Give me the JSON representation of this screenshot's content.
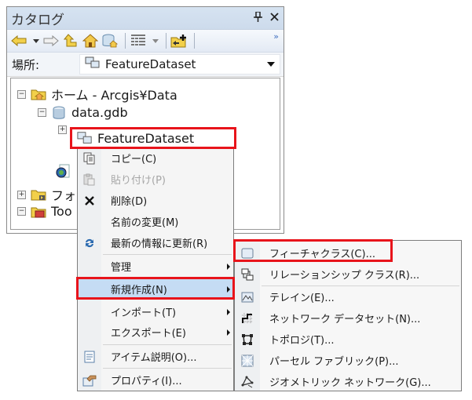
{
  "panel": {
    "title": "カタログ",
    "pin_icon": "pin-icon",
    "close_icon": "close-icon",
    "toolbar": {
      "items": [
        "back-arrow-icon",
        "back-dropdown-icon",
        "forward-arrow-icon",
        "up-one-level-icon",
        "home-icon",
        "default-geodatabase-icon",
        "view-toggle-icon",
        "view-dropdown-icon",
        "connect-folder-icon"
      ],
      "overflow": "»"
    },
    "location": {
      "label": "場所:",
      "value": "FeatureDataset"
    }
  },
  "tree": {
    "nodes": [
      {
        "label": "ホーム - Arcgis¥Data",
        "expander": "−",
        "icon": "home-folder-icon"
      },
      {
        "label": "data.gdb",
        "expander": "−",
        "icon": "geodatabase-icon"
      },
      {
        "label": "FeatureDataset",
        "expander": "+",
        "icon": "feature-dataset-icon",
        "selected": true
      },
      {
        "label": "フォ",
        "expander": "+",
        "icon": "folder-connections-icon"
      },
      {
        "label": "Too",
        "expander": "−",
        "icon": "toolboxes-icon"
      }
    ]
  },
  "context_menu": {
    "items": [
      {
        "label": "コピー(C)",
        "icon": "copy-icon"
      },
      {
        "label": "貼り付け(P)",
        "icon": "paste-icon",
        "disabled": true
      },
      {
        "label": "削除(D)",
        "icon": "delete-icon"
      },
      {
        "label": "名前の変更(M)",
        "icon": ""
      },
      {
        "label": "最新の情報に更新(R)",
        "icon": "refresh-icon"
      },
      {
        "label": "管理",
        "submenu": true
      },
      {
        "label": "新規作成(N)",
        "submenu": true,
        "highlighted": true
      },
      {
        "label": "インポート(T)",
        "submenu": true
      },
      {
        "label": "エクスポート(E)",
        "submenu": true
      },
      {
        "label": "アイテム説明(O)...",
        "icon": "item-description-icon"
      },
      {
        "label": "プロパティ(I)...",
        "icon": "properties-icon"
      }
    ]
  },
  "submenu_new": {
    "items": [
      {
        "label": "フィーチャクラス(C)...",
        "icon": "feature-class-icon"
      },
      {
        "label": "リレーションシップ クラス(R)...",
        "icon": "relationship-class-icon"
      },
      {
        "label": "テレイン(E)...",
        "icon": "terrain-icon"
      },
      {
        "label": "ネットワーク データセット(N)...",
        "icon": "network-dataset-icon"
      },
      {
        "label": "トポロジ(T)...",
        "icon": "topology-icon"
      },
      {
        "label": "パーセル ファブリック(P)...",
        "icon": "parcel-fabric-icon"
      },
      {
        "label": "ジオメトリック ネットワーク(G)...",
        "icon": "geometric-network-icon"
      }
    ]
  },
  "highlight_color": "#e8141b"
}
